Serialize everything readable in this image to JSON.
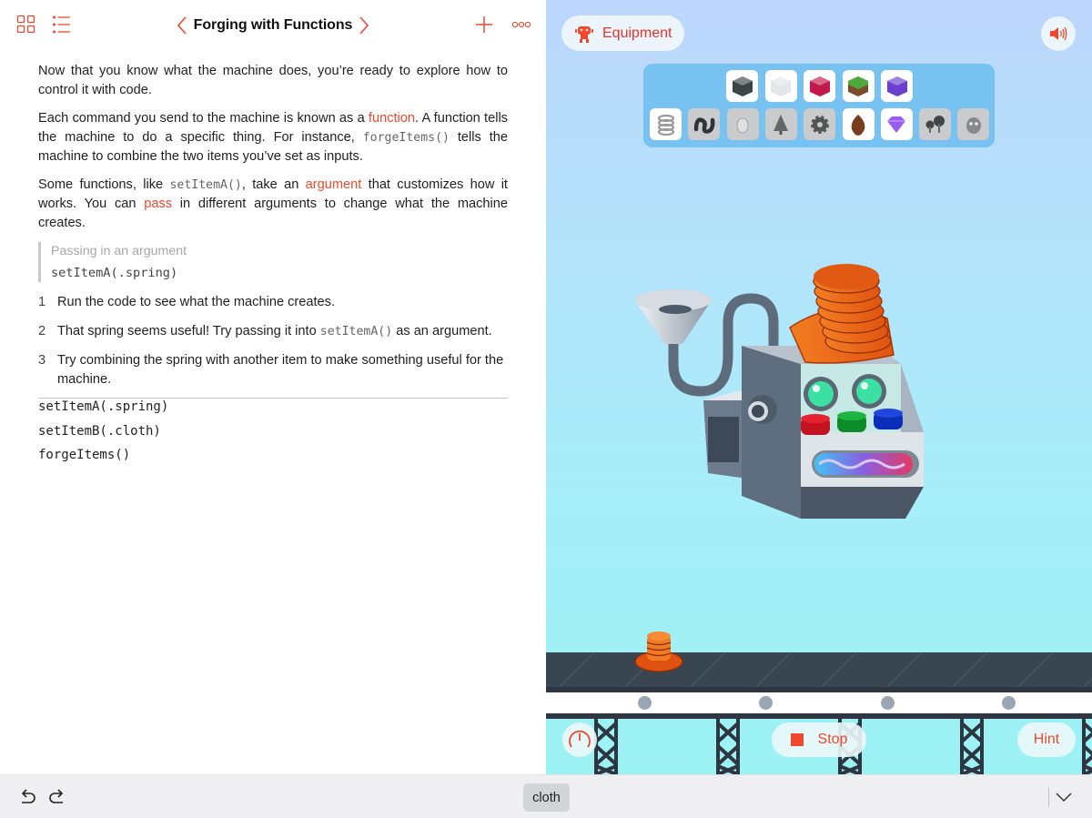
{
  "colors": {
    "accent": "#f0472d",
    "title": "#111111",
    "muted": "#a7a7a7"
  },
  "toolbar": {
    "icons": [
      "grid-icon",
      "list-icon",
      "chevron-left-icon",
      "chevron-right-icon",
      "plus-icon",
      "more-icon"
    ],
    "title": "Forging with Functions"
  },
  "content": {
    "para1": "Now that you know what the machine does, you’re ready to explore how to control it with code.",
    "para2": {
      "pre": "Each command you send to the machine is known as a ",
      "link": "function",
      "mid": ". A function tells the machine to do a specific thing. For instance, ",
      "code": "forgeItems()",
      "post": " tells the machine to combine the two items you’ve set as inputs."
    },
    "para3": {
      "pre": "Some functions, like ",
      "code": "setItemA()",
      "mid": ", take an ",
      "link1": "argument",
      "mid2": " that customizes how it works. You can ",
      "link2": "pass",
      "post": " in different arguments to change what the machine creates."
    },
    "callout": {
      "title": "Passing in an argument",
      "code": "setItemA(.spring)"
    },
    "steps": [
      {
        "num": "1",
        "text": "Run the code to see what the machine creates."
      },
      {
        "num": "2",
        "pre": "That spring seems useful! Try passing it into ",
        "code": "setItemA()",
        "post": " as an argument."
      },
      {
        "num": "3",
        "text": "Try combining the spring with another item to make something useful for the machine."
      }
    ],
    "code_lines": [
      "setItemA(.spring)",
      "setItemB(.cloth)",
      "forgeItems()"
    ]
  },
  "liveview": {
    "equipment_label": "Equipment",
    "equipment_icon": "robot-icon",
    "sound_icon": "speaker-icon",
    "tray": {
      "row1": [
        {
          "name": "metal-block",
          "locked": false,
          "color": "#3d4445"
        },
        {
          "name": "ice-block",
          "locked": false,
          "color": "#e3e6ea"
        },
        {
          "name": "crystal-block",
          "locked": false,
          "color": "#c2184a"
        },
        {
          "name": "grass-block",
          "locked": false,
          "color": "#4eaa3e"
        },
        {
          "name": "magic-block",
          "locked": false,
          "color": "#6a3fd0"
        }
      ],
      "row2": [
        {
          "name": "spring",
          "locked": false,
          "color": "#9a9a9a"
        },
        {
          "name": "cloth",
          "locked": true,
          "color": "#333333"
        },
        {
          "name": "egg",
          "locked": true,
          "color": "#e0e0e0"
        },
        {
          "name": "tree",
          "locked": true,
          "color": "#666666"
        },
        {
          "name": "gear",
          "locked": true,
          "color": "#555555"
        },
        {
          "name": "seed",
          "locked": false,
          "color": "#7a3d1c"
        },
        {
          "name": "gem",
          "locked": false,
          "color": "#9b5cf2"
        },
        {
          "name": "mushrooms",
          "locked": true,
          "color": "#444444"
        },
        {
          "name": "rock-creature",
          "locked": true,
          "color": "#888888"
        }
      ]
    },
    "stop_label": "Stop",
    "hint_label": "Hint",
    "speed_icon": "speedometer-icon"
  },
  "bottombar": {
    "suggestion": "cloth",
    "icons": [
      "undo-icon",
      "redo-icon",
      "hide-keyboard-icon"
    ]
  }
}
